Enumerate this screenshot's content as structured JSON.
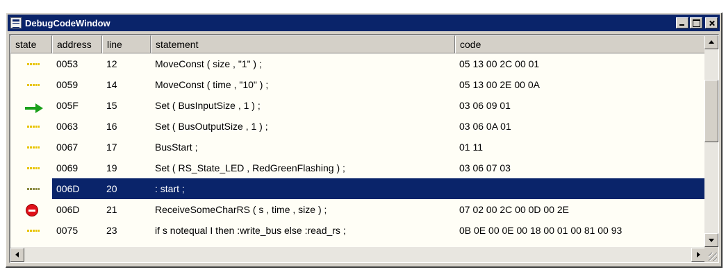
{
  "window": {
    "title": "DebugCodeWindow",
    "icon": "app-window-icon",
    "controls": [
      "minimize-icon",
      "maximize-icon",
      "close-icon"
    ]
  },
  "columns": {
    "state": "state",
    "address": "address",
    "line": "line",
    "statement": "statement",
    "code": "code"
  },
  "rows": [
    {
      "marker": "dots",
      "address": "0053",
      "line": "12",
      "statement": "MoveConst ( size , \"1\" ) ;",
      "code": "05 13 00 2C 00 01"
    },
    {
      "marker": "dots",
      "address": "0059",
      "line": "14",
      "statement": "MoveConst ( time , \"10\" ) ;",
      "code": "05 13 00 2E 00 0A"
    },
    {
      "marker": "arrow",
      "address": "005F",
      "line": "15",
      "statement": "Set ( BusInputSize , 1 ) ;",
      "code": "03 06 09 01"
    },
    {
      "marker": "dots",
      "address": "0063",
      "line": "16",
      "statement": "Set ( BusOutputSize , 1 ) ;",
      "code": "03 06 0A 01"
    },
    {
      "marker": "dots",
      "address": "0067",
      "line": "17",
      "statement": "BusStart ;",
      "code": "01 11"
    },
    {
      "marker": "dots",
      "address": "0069",
      "line": "19",
      "statement": "Set ( RS_State_LED , RedGreenFlashing ) ;",
      "code": "03 06 07 03"
    },
    {
      "marker": "dots-dark",
      "address": "006D",
      "line": "20",
      "statement": ": start ;",
      "code": "",
      "selected": true
    },
    {
      "marker": "stop",
      "address": "006D",
      "line": "21",
      "statement": "ReceiveSomeCharRS ( s , time , size ) ;",
      "code": "07 02 00 2C 00 0D 00 2E"
    },
    {
      "marker": "dots",
      "address": "0075",
      "line": "23",
      "statement": "if s notequal I then :write_bus else :read_rs ;",
      "code": "0B 0E 00 0E 00 18 00 01 00 81 00 93"
    }
  ],
  "scroll": {
    "vertical_position": 0.25,
    "horizontal_position": 0.0
  },
  "colors": {
    "title_bar": "#0a246a",
    "selection": "#0a246a",
    "grid_background": "#fffef6",
    "dots_marker": "#e8c400",
    "arrow_marker": "#1aa01a",
    "stop_marker": "#e0101a"
  }
}
